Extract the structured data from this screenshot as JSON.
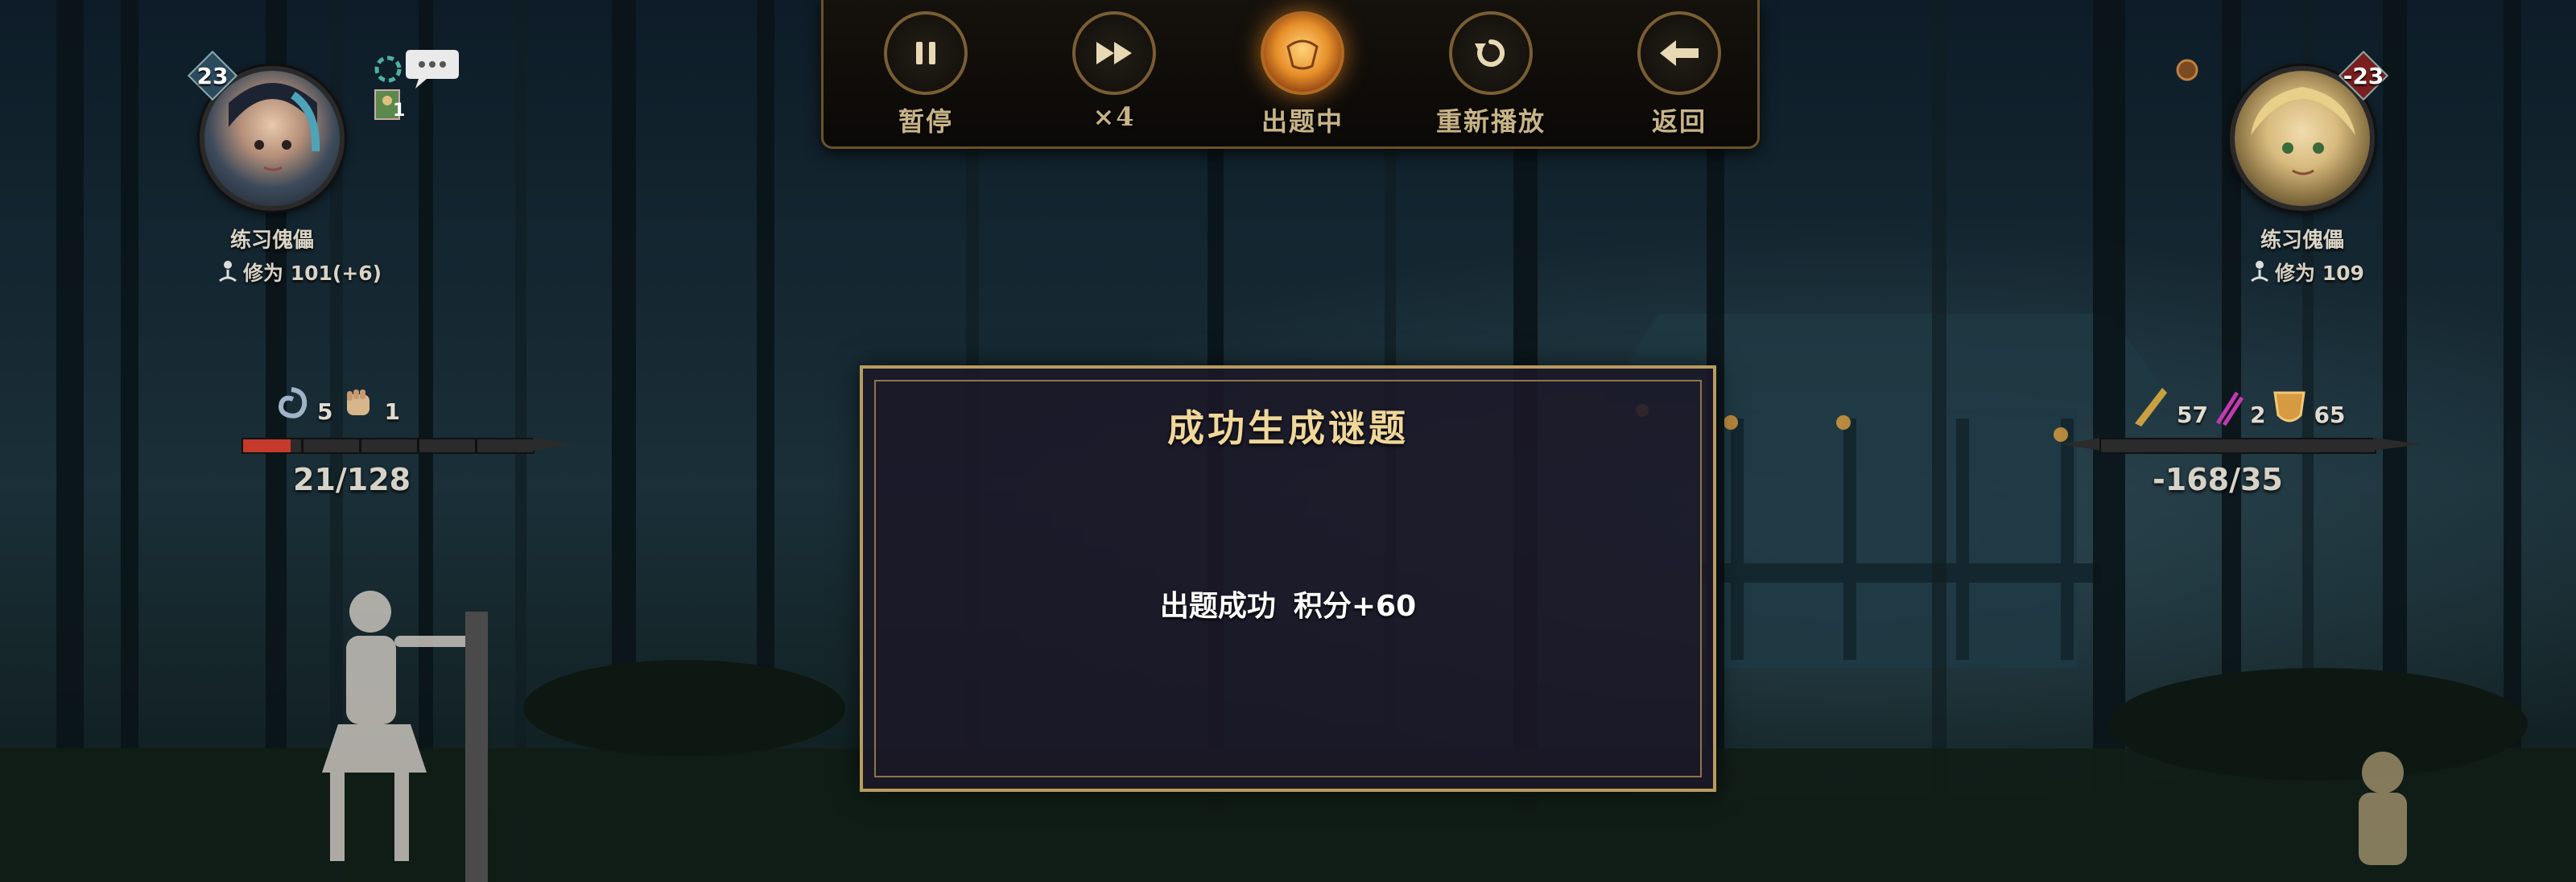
{
  "controls": [
    {
      "id": "pause",
      "label": "暂停",
      "icon": "pause-icon"
    },
    {
      "id": "speed",
      "label": "×4",
      "icon": "fast-forward-icon"
    },
    {
      "id": "status",
      "label": "出题中",
      "icon": "lantern-icon"
    },
    {
      "id": "replay",
      "label": "重新播放",
      "icon": "replay-icon"
    },
    {
      "id": "back",
      "label": "返回",
      "icon": "back-arrow-icon"
    }
  ],
  "left_player": {
    "level": "23",
    "name": "练习傀儡",
    "cultivation": "修为 101(+6)",
    "buff_count": "1",
    "stats": [
      {
        "icon": "swirl-icon",
        "value": "5"
      },
      {
        "icon": "fist-icon",
        "value": "1"
      }
    ],
    "hp_text": "21/128",
    "hp_fraction": 0.164
  },
  "right_player": {
    "level": "-23",
    "name": "练习傀儡",
    "cultivation": "修为 109",
    "stats": [
      {
        "icon": "blade-icon",
        "value": "57"
      },
      {
        "icon": "claw-icon",
        "value": "2"
      },
      {
        "icon": "shield-icon",
        "value": "65"
      }
    ],
    "hp_text": "-168/35",
    "hp_fraction": 0
  },
  "dialog": {
    "title": "成功生成谜题",
    "message_left": "出题成功",
    "message_right": "积分+60"
  },
  "colors": {
    "gold": "#b99b5e",
    "hp_red": "#c53a2c",
    "title_gold": "#f0d79a"
  }
}
